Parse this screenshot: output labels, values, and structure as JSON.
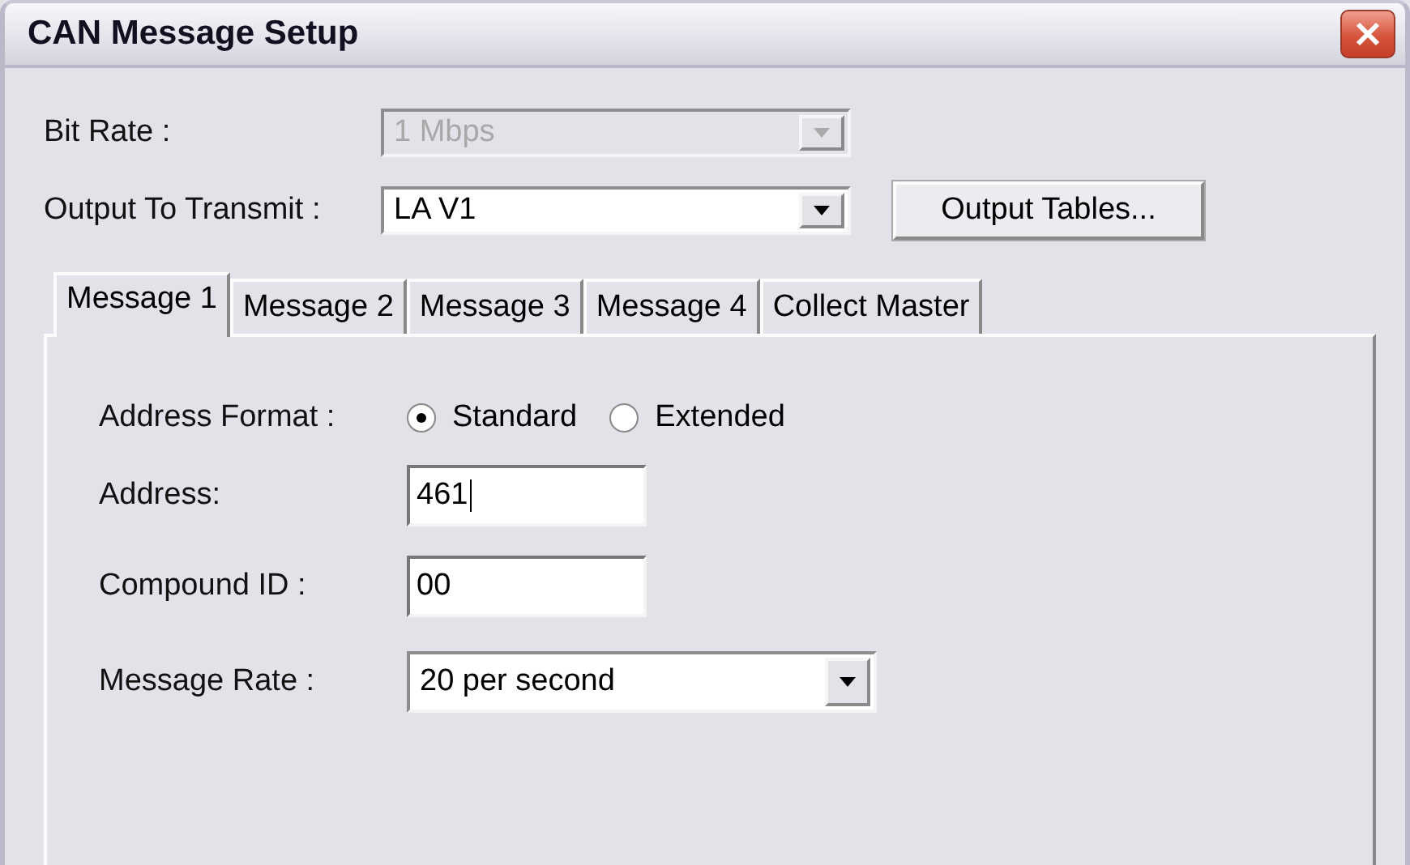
{
  "window": {
    "title": "CAN Message Setup"
  },
  "bit_rate": {
    "label": "Bit Rate :",
    "value": "1 Mbps",
    "disabled": true
  },
  "output_to_transmit": {
    "label": "Output To Transmit :",
    "value": "LA V1",
    "disabled": false
  },
  "output_tables_button": {
    "label": "Output Tables..."
  },
  "tabs": [
    {
      "label": "Message 1",
      "selected": true
    },
    {
      "label": "Message 2",
      "selected": false
    },
    {
      "label": "Message 3",
      "selected": false
    },
    {
      "label": "Message 4",
      "selected": false
    },
    {
      "label": "Collect Master",
      "selected": false
    }
  ],
  "address_format": {
    "label": "Address Format :",
    "options": [
      {
        "label": "Standard",
        "selected": true
      },
      {
        "label": "Extended",
        "selected": false
      }
    ]
  },
  "address": {
    "label": "Address:",
    "value": "461"
  },
  "compound_id": {
    "label": "Compound ID :",
    "value": "00"
  },
  "message_rate": {
    "label": "Message Rate :",
    "value": "20 per second"
  }
}
